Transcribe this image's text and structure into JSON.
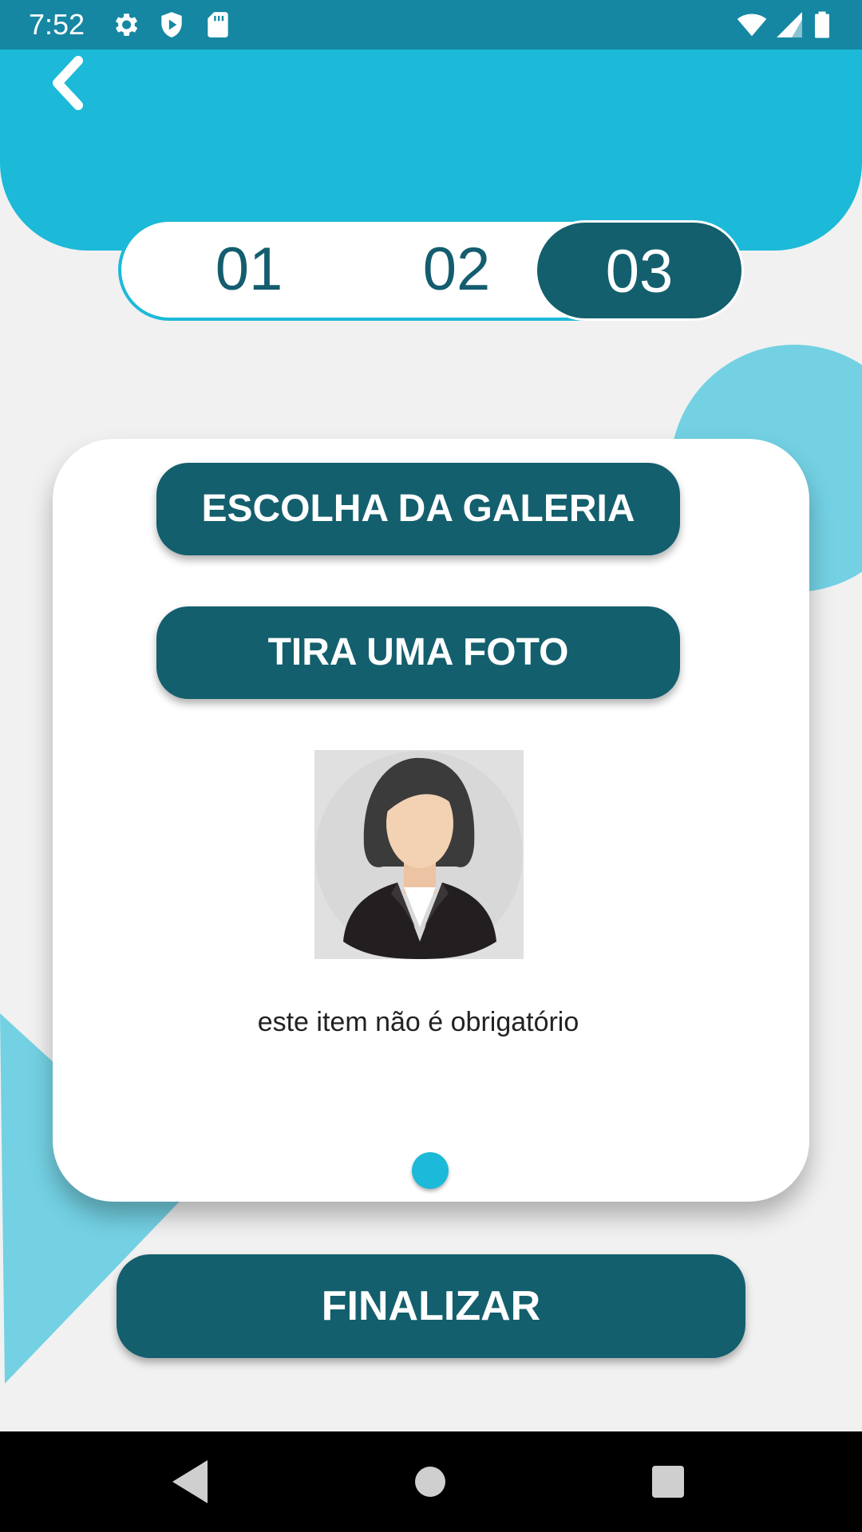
{
  "status_bar": {
    "time": "7:52",
    "icons": [
      "gear-icon",
      "shield-play-icon",
      "sd-card-icon",
      "wifi-icon",
      "cell-signal-icon",
      "battery-icon"
    ]
  },
  "header": {
    "back_icon": "chevron-left-icon"
  },
  "stepper": {
    "steps": [
      "01",
      "02",
      "03"
    ],
    "active_step": 3
  },
  "card": {
    "gallery_button": "ESCOLHA DA GALERIA",
    "photo_button": "TIRA UMA FOTO",
    "avatar_icon": "user-avatar-placeholder",
    "note": "este item não é obrigatório",
    "page_indicator_icon": "dot-indicator"
  },
  "footer": {
    "finalize_button": "FINALIZAR"
  },
  "nav": {
    "icons": [
      "back-triangle-icon",
      "home-circle-icon",
      "recents-square-icon"
    ]
  },
  "colors": {
    "accent": "#1cb9d8",
    "primary_dark": "#135f6d",
    "status_bar": "#1687a2",
    "background": "#f1f1f1"
  }
}
